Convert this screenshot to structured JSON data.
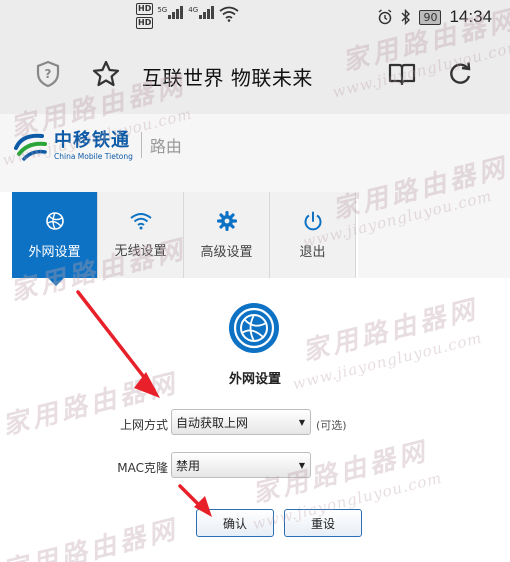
{
  "status_bar": {
    "hd_badges": [
      "HD",
      "HD"
    ],
    "network_labels": [
      "5G",
      "4G"
    ],
    "battery": "90",
    "time": "14:34"
  },
  "browser": {
    "page_title": "互联世界 物联未来"
  },
  "router": {
    "brand_cn": "中移铁通",
    "brand_en": "China Mobile Tietong",
    "label": "路由"
  },
  "nav": {
    "items": [
      {
        "label": "外网设置",
        "icon": "globe-icon",
        "active": true
      },
      {
        "label": "无线设置",
        "icon": "wifi-icon",
        "active": false
      },
      {
        "label": "高级设置",
        "icon": "gear-icon",
        "active": false
      },
      {
        "label": "退出",
        "icon": "power-icon",
        "active": false
      }
    ]
  },
  "wan": {
    "title": "外网设置",
    "connection_type_label": "上网方式",
    "connection_type_value": "自动获取上网",
    "connection_type_hint": "(可选)",
    "mac_clone_label": "MAC克隆",
    "mac_clone_value": "禁用",
    "confirm_label": "确认",
    "reset_label": "重设"
  },
  "watermark": {
    "cn": "家用路由器网",
    "en": "www.jiayongluyou.com"
  },
  "colors": {
    "accent": "#0e72c4",
    "brand": "#0d5aa7",
    "annotation": "#e8202a"
  }
}
